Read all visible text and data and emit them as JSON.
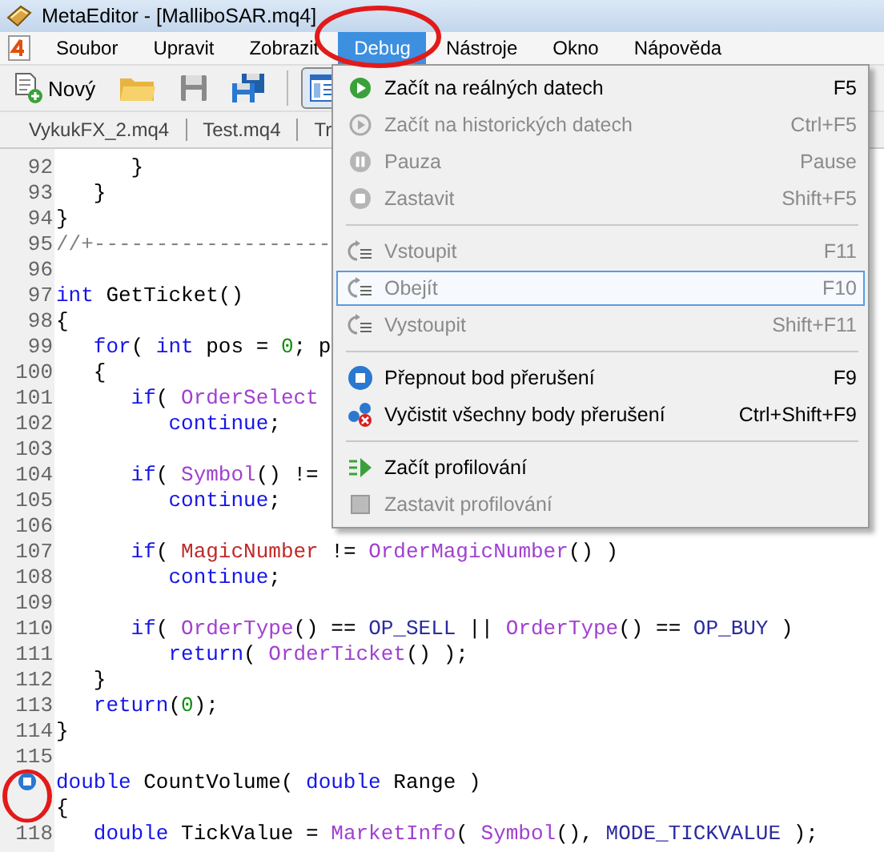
{
  "window": {
    "title": "MetaEditor - [MalliboSAR.mq4]"
  },
  "menu_bar": [
    {
      "label": "Soubor",
      "selected": false
    },
    {
      "label": "Upravit",
      "selected": false
    },
    {
      "label": "Zobrazit",
      "selected": false
    },
    {
      "label": "Debug",
      "selected": true
    },
    {
      "label": "Nástroje",
      "selected": false
    },
    {
      "label": "Okno",
      "selected": false
    },
    {
      "label": "Nápověda",
      "selected": false
    }
  ],
  "toolbar": [
    {
      "kind": "new",
      "label": "Nový",
      "pressed": false
    },
    {
      "kind": "open",
      "pressed": false
    },
    {
      "kind": "save",
      "pressed": false
    },
    {
      "kind": "save-all",
      "pressed": false
    },
    {
      "kind": "separator"
    },
    {
      "kind": "view",
      "pressed": true
    }
  ],
  "tabs": [
    {
      "label": "VykukFX_2.mq4",
      "selected": false
    },
    {
      "label": "Test.mq4",
      "selected": false
    },
    {
      "label": "Tr",
      "selected": false
    }
  ],
  "code_lines": [
    {
      "number": "92",
      "tokens": [
        {
          "kind": "plain",
          "text": "      }"
        }
      ]
    },
    {
      "number": "93",
      "tokens": [
        {
          "kind": "plain",
          "text": "   }"
        }
      ]
    },
    {
      "number": "94",
      "tokens": [
        {
          "kind": "plain",
          "text": "}"
        }
      ]
    },
    {
      "number": "95",
      "tokens": [
        {
          "kind": "comment",
          "text": "//+-------------------"
        }
      ]
    },
    {
      "number": "96"
    },
    {
      "number": "97",
      "tokens": [
        {
          "kind": "keyword",
          "text": "int"
        },
        {
          "kind": "plain",
          "text": " GetTicket()"
        }
      ]
    },
    {
      "number": "98",
      "tokens": [
        {
          "kind": "plain",
          "text": "{"
        }
      ]
    },
    {
      "number": "99",
      "tokens": [
        {
          "kind": "keyword",
          "text": "   for"
        },
        {
          "kind": "plain",
          "text": "( "
        },
        {
          "kind": "keyword",
          "text": "int"
        },
        {
          "kind": "plain",
          "text": " pos = "
        },
        {
          "kind": "number",
          "text": "0"
        },
        {
          "kind": "plain",
          "text": "; p"
        }
      ]
    },
    {
      "number": "100",
      "tokens": [
        {
          "kind": "plain",
          "text": "   {"
        }
      ]
    },
    {
      "number": "101",
      "tokens": [
        {
          "kind": "keyword",
          "text": "      if"
        },
        {
          "kind": "plain",
          "text": "( "
        },
        {
          "kind": "function",
          "text": "OrderSelect"
        }
      ]
    },
    {
      "number": "102",
      "tokens": [
        {
          "kind": "keyword",
          "text": "         continue"
        },
        {
          "kind": "plain",
          "text": ";"
        }
      ]
    },
    {
      "number": "103"
    },
    {
      "number": "104",
      "tokens": [
        {
          "kind": "keyword",
          "text": "      if"
        },
        {
          "kind": "plain",
          "text": "( "
        },
        {
          "kind": "function",
          "text": "Symbol"
        },
        {
          "kind": "plain",
          "text": "() !="
        }
      ]
    },
    {
      "number": "105",
      "tokens": [
        {
          "kind": "keyword",
          "text": "         continue"
        },
        {
          "kind": "plain",
          "text": ";"
        }
      ]
    },
    {
      "number": "106"
    },
    {
      "number": "107",
      "tokens": [
        {
          "kind": "keyword",
          "text": "      if"
        },
        {
          "kind": "plain",
          "text": "( "
        },
        {
          "kind": "variable",
          "text": "MagicNumber"
        },
        {
          "kind": "plain",
          "text": " != "
        },
        {
          "kind": "function",
          "text": "OrderMagicNumber"
        },
        {
          "kind": "plain",
          "text": "() )"
        }
      ]
    },
    {
      "number": "108",
      "tokens": [
        {
          "kind": "keyword",
          "text": "         continue"
        },
        {
          "kind": "plain",
          "text": ";"
        }
      ]
    },
    {
      "number": "109"
    },
    {
      "number": "110",
      "tokens": [
        {
          "kind": "keyword",
          "text": "      if"
        },
        {
          "kind": "plain",
          "text": "( "
        },
        {
          "kind": "function",
          "text": "OrderType"
        },
        {
          "kind": "plain",
          "text": "() == "
        },
        {
          "kind": "constant",
          "text": "OP_SELL"
        },
        {
          "kind": "plain",
          "text": " || "
        },
        {
          "kind": "function",
          "text": "OrderType"
        },
        {
          "kind": "plain",
          "text": "() == "
        },
        {
          "kind": "constant",
          "text": "OP_BUY"
        },
        {
          "kind": "plain",
          "text": " )"
        }
      ]
    },
    {
      "number": "111",
      "tokens": [
        {
          "kind": "keyword",
          "text": "         return"
        },
        {
          "kind": "plain",
          "text": "( "
        },
        {
          "kind": "function",
          "text": "OrderTicket"
        },
        {
          "kind": "plain",
          "text": "() );"
        }
      ]
    },
    {
      "number": "112",
      "tokens": [
        {
          "kind": "plain",
          "text": "   }"
        }
      ]
    },
    {
      "number": "113",
      "tokens": [
        {
          "kind": "keyword",
          "text": "   return"
        },
        {
          "kind": "plain",
          "text": "("
        },
        {
          "kind": "number",
          "text": "0"
        },
        {
          "kind": "plain",
          "text": ");"
        }
      ]
    },
    {
      "number": "114",
      "tokens": [
        {
          "kind": "plain",
          "text": "}"
        }
      ]
    },
    {
      "number": "115"
    },
    {
      "breakpoint": true,
      "tokens": [
        {
          "kind": "keyword",
          "text": "double"
        },
        {
          "kind": "plain",
          "text": " CountVolume( "
        },
        {
          "kind": "keyword",
          "text": "double"
        },
        {
          "kind": "plain",
          "text": " Range )"
        }
      ]
    },
    {
      "tokens": [
        {
          "kind": "plain",
          "text": "{"
        }
      ]
    },
    {
      "number": "118",
      "tokens": [
        {
          "kind": "keyword",
          "text": "   double"
        },
        {
          "kind": "plain",
          "text": " TickValue = "
        },
        {
          "kind": "function",
          "text": "MarketInfo"
        },
        {
          "kind": "plain",
          "text": "( "
        },
        {
          "kind": "function",
          "text": "Symbol"
        },
        {
          "kind": "plain",
          "text": "(), "
        },
        {
          "kind": "constant",
          "text": "MODE_TICKVALUE"
        },
        {
          "kind": "plain",
          "text": " );"
        }
      ]
    }
  ],
  "debug_menu": [
    [
      {
        "kind": "play",
        "label": "Začít na reálných datech",
        "shortcut": "F5",
        "disabled": false,
        "selected": false
      },
      {
        "kind": "replay",
        "label": "Začít na historických datech",
        "shortcut": "Ctrl+F5",
        "disabled": true,
        "selected": false
      },
      {
        "kind": "pause",
        "label": "Pauza",
        "shortcut": "Pause",
        "disabled": true,
        "selected": false
      },
      {
        "kind": "stop",
        "label": "Zastavit",
        "shortcut": "Shift+F5",
        "disabled": true,
        "selected": false
      }
    ],
    [
      {
        "kind": "step",
        "label": "Vstoupit",
        "shortcut": "F11",
        "disabled": true,
        "selected": false
      },
      {
        "kind": "step",
        "label": "Obejít",
        "shortcut": "F10",
        "disabled": true,
        "selected": true
      },
      {
        "kind": "step",
        "label": "Vystoupit",
        "shortcut": "Shift+F11",
        "disabled": true,
        "selected": false
      }
    ],
    [
      {
        "kind": "breakpoint",
        "label": "Přepnout bod přerušení",
        "shortcut": "F9",
        "disabled": false,
        "selected": false
      },
      {
        "kind": "clear",
        "label": "Vyčistit všechny body přerušení",
        "shortcut": "Ctrl+Shift+F9",
        "disabled": false,
        "selected": false
      }
    ],
    [
      {
        "kind": "profile",
        "label": "Začít profilování",
        "disabled": false,
        "selected": false
      },
      {
        "kind": "square",
        "label": "Zastavit profilování",
        "disabled": true,
        "selected": false
      }
    ]
  ]
}
